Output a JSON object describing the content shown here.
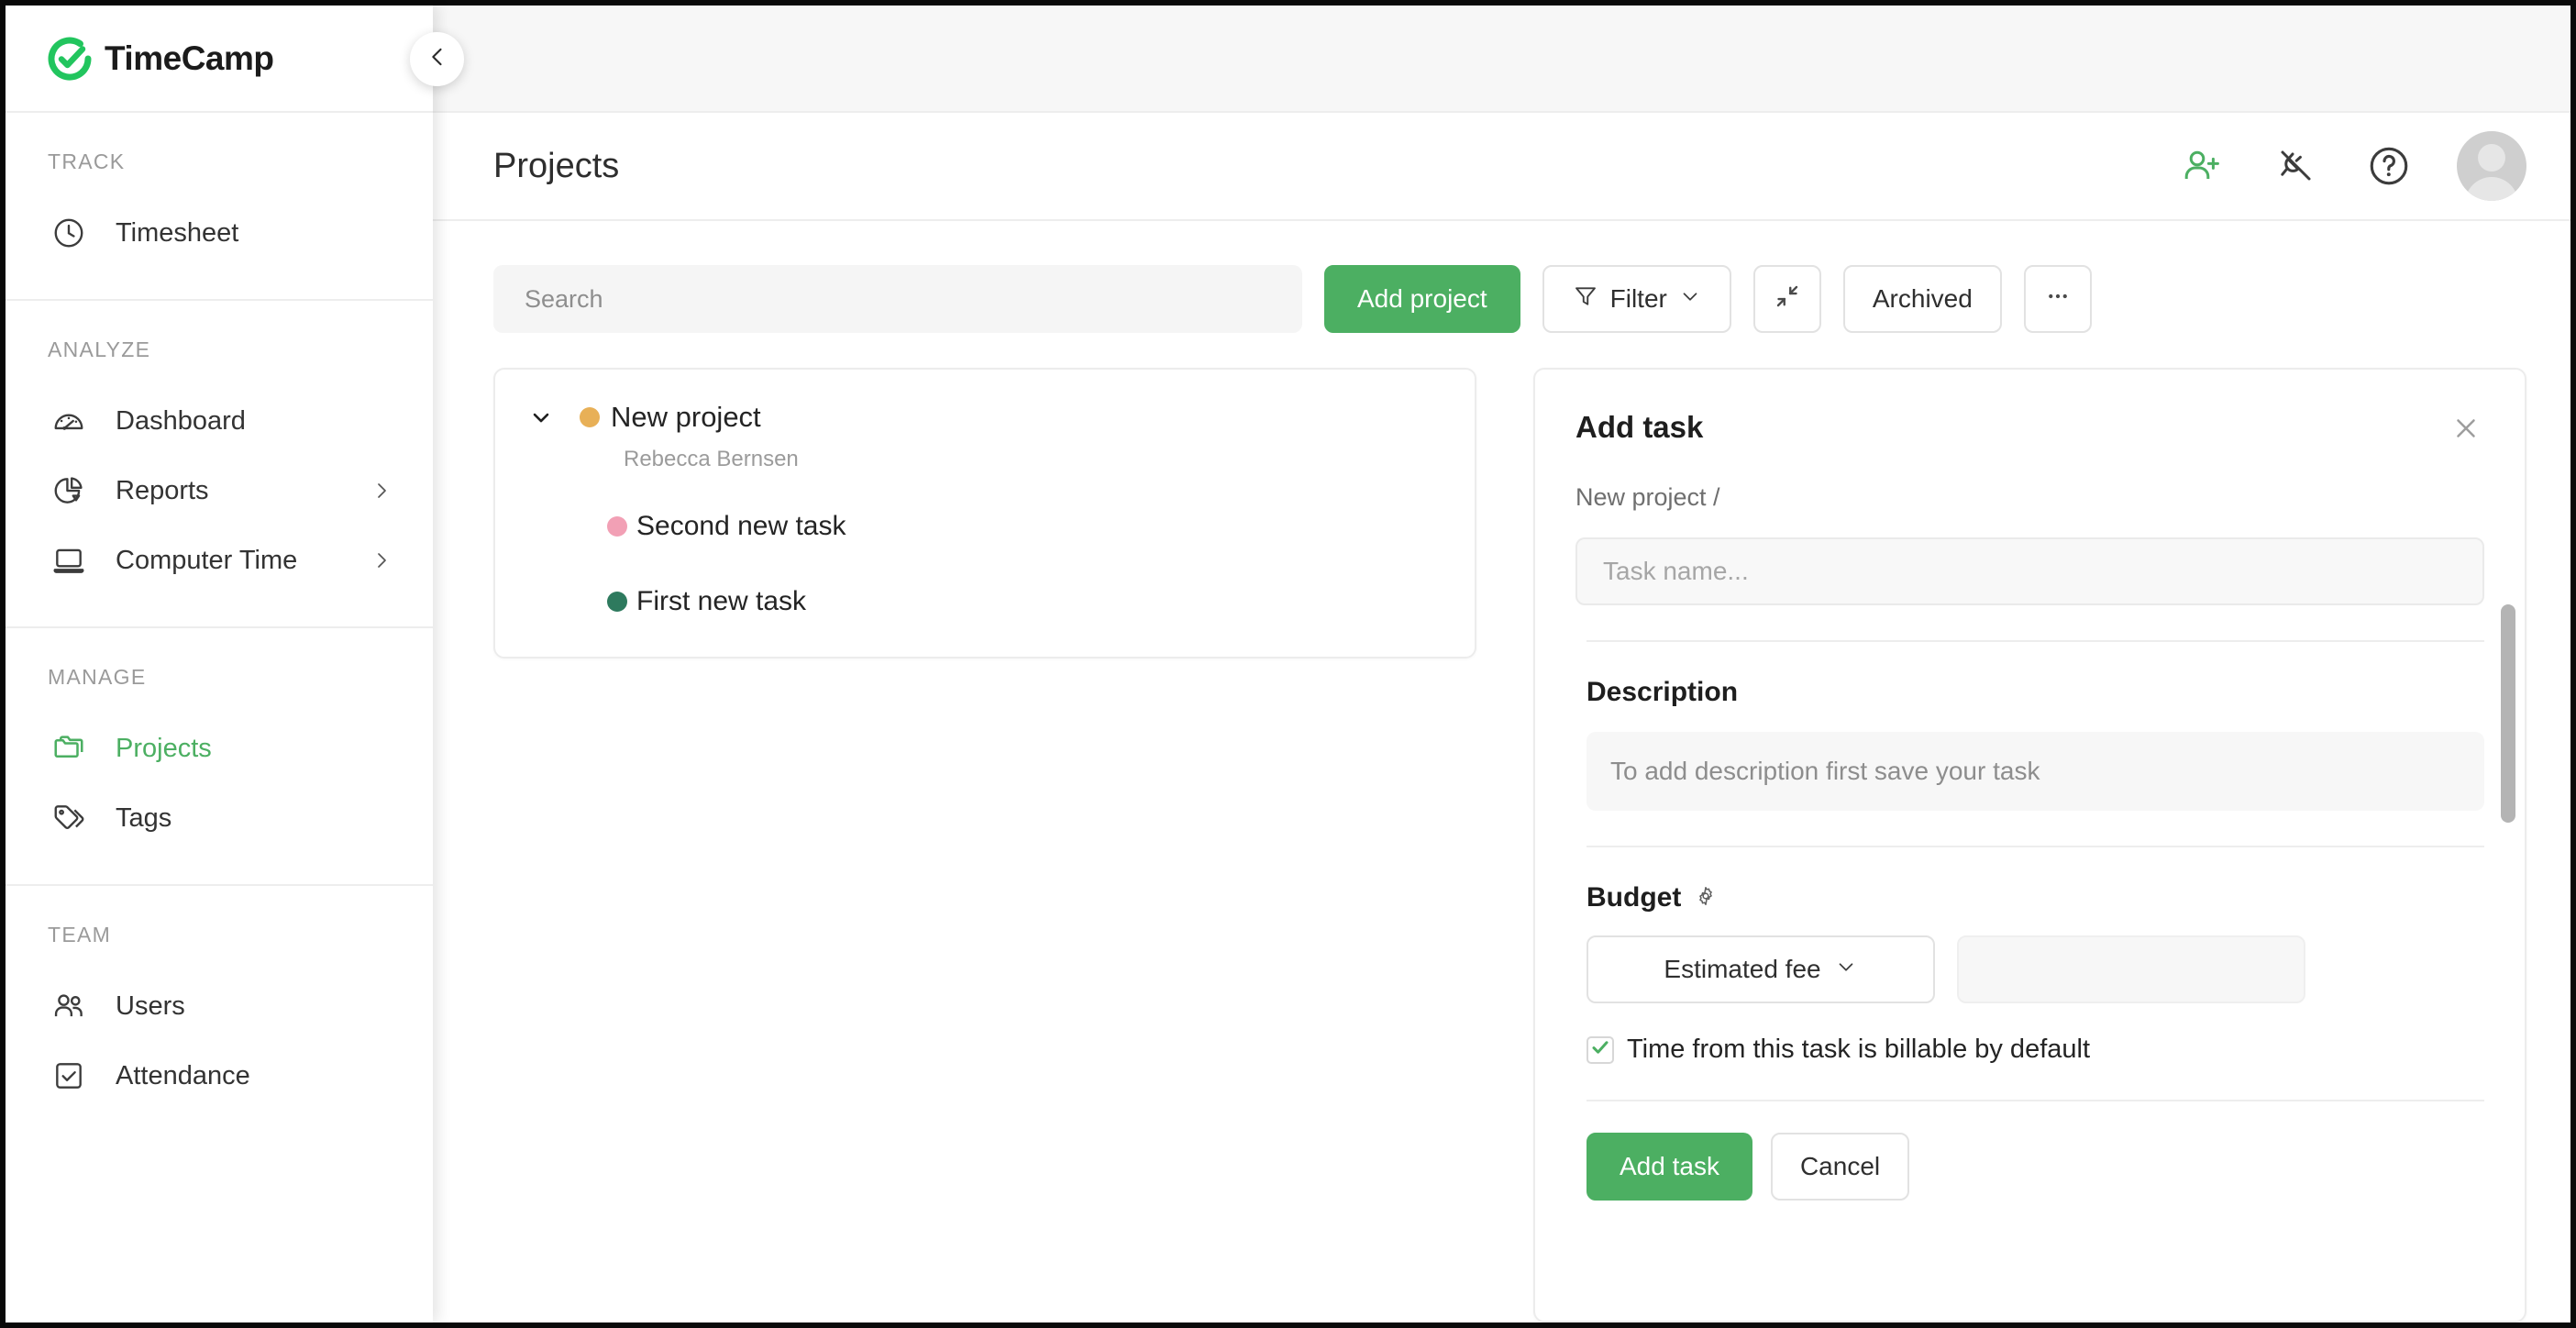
{
  "brand": {
    "name": "TimeCamp",
    "accent": "#4caf62",
    "logo_icon": "timecamp-check-logo"
  },
  "sidebar": {
    "collapse_button_icon": "chevron-left-icon",
    "groups": [
      {
        "label": "TRACK",
        "items": [
          {
            "label": "Timesheet",
            "icon": "clock-icon",
            "active": false,
            "has_submenu": false
          }
        ]
      },
      {
        "label": "ANALYZE",
        "items": [
          {
            "label": "Dashboard",
            "icon": "gauge-icon",
            "active": false,
            "has_submenu": false
          },
          {
            "label": "Reports",
            "icon": "pie-chart-icon",
            "active": false,
            "has_submenu": true
          },
          {
            "label": "Computer Time",
            "icon": "laptop-icon",
            "active": false,
            "has_submenu": true
          }
        ]
      },
      {
        "label": "MANAGE",
        "items": [
          {
            "label": "Projects",
            "icon": "folder-icon",
            "active": true,
            "has_submenu": false
          },
          {
            "label": "Tags",
            "icon": "tag-icon",
            "active": false,
            "has_submenu": false
          }
        ]
      },
      {
        "label": "TEAM",
        "items": [
          {
            "label": "Users",
            "icon": "users-icon",
            "active": false,
            "has_submenu": false
          },
          {
            "label": "Attendance",
            "icon": "checkbox-icon",
            "active": false,
            "has_submenu": false
          }
        ]
      }
    ]
  },
  "header": {
    "title": "Projects",
    "actions": [
      {
        "icon": "add-user-icon",
        "color": "#4caf62"
      },
      {
        "icon": "plug-disconnected-icon",
        "color": "#3c3c3c"
      },
      {
        "icon": "help-circle-icon",
        "color": "#3c3c3c"
      }
    ],
    "avatar_icon": "user-avatar"
  },
  "toolbar": {
    "search_placeholder": "Search",
    "search_value": "",
    "add_project_label": "Add project",
    "filter_label": "Filter",
    "filter_icon": "funnel-icon",
    "filter_chevron_icon": "chevron-down-icon",
    "collapse_all_icon": "collapse-arrows-icon",
    "archived_label": "Archived",
    "more_label": "•••",
    "more_icon": "ellipsis-icon"
  },
  "project_tree": {
    "projects": [
      {
        "name": "New project",
        "dot_color": "#e8b057",
        "owner": "Rebecca Bernsen",
        "expanded": true,
        "expand_icon": "chevron-down-icon",
        "tasks": [
          {
            "name": "Second new task",
            "dot_color": "#f2a0b5"
          },
          {
            "name": "First new task",
            "dot_color": "#2e7a5e"
          }
        ]
      }
    ]
  },
  "add_task_panel": {
    "title": "Add task",
    "close_icon": "close-icon",
    "breadcrumb": "New project /",
    "task_name_placeholder": "Task name...",
    "task_name_value": "",
    "description_label": "Description",
    "description_placeholder": "To add description first save your task",
    "budget_label": "Budget",
    "budget_settings_icon": "gear-icon",
    "budget_type_value": "Estimated fee",
    "budget_type_chevron_icon": "chevron-down-icon",
    "budget_amount_value": "",
    "billable_label": "Time from this task is billable by default",
    "billable_checked": true,
    "billable_check_icon": "check-icon",
    "submit_label": "Add task",
    "cancel_label": "Cancel"
  }
}
